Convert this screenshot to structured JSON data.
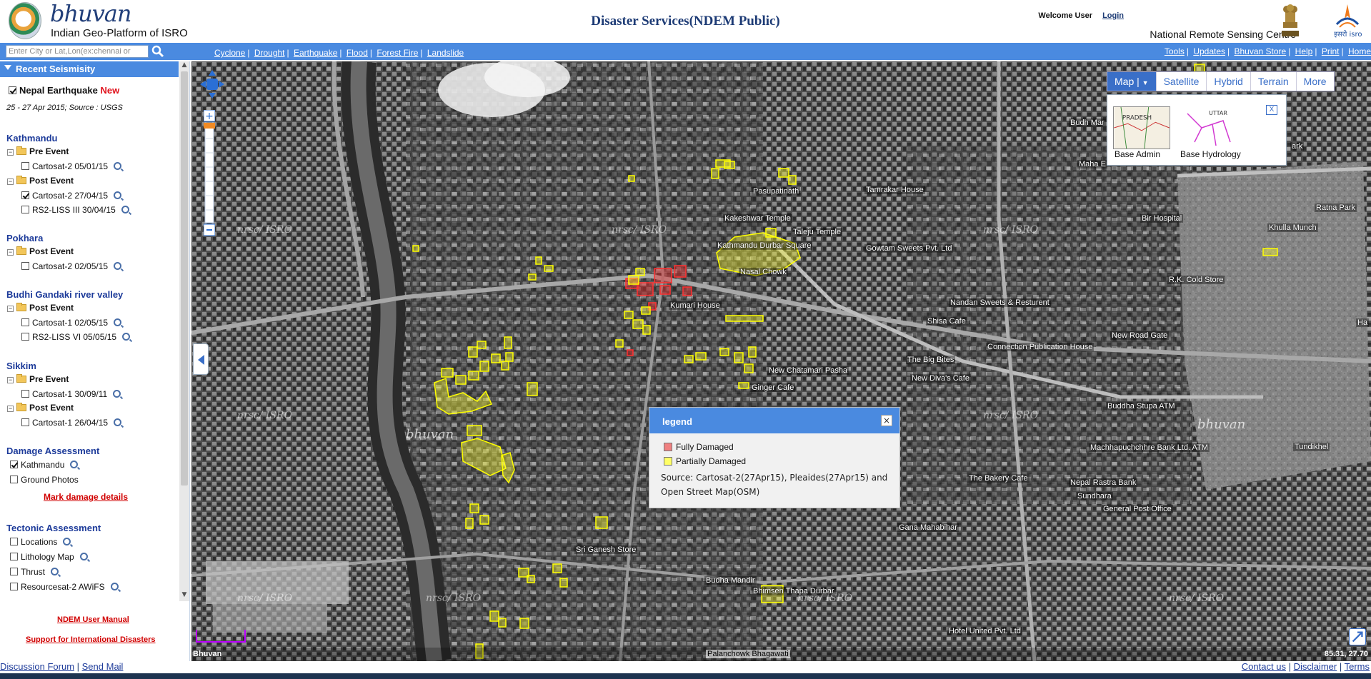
{
  "header": {
    "logo_word": "bhuvan",
    "logo_tagline": "Indian Geo-Platform of ISRO",
    "title": "Disaster Services(NDEM Public)",
    "welcome": "Welcome User",
    "login": "Login",
    "org": "National Remote Sensing Centre"
  },
  "toolbar": {
    "search_placeholder": "Enter City or Lat,Lon(ex:chennai or",
    "disasters": [
      "Cyclone",
      "Drought",
      "Earthquake",
      "Flood",
      "Forest Fire",
      "Landslide"
    ],
    "tools": [
      "Tools",
      "Updates",
      "Bhuvan Store",
      "Help",
      "Print",
      "Home"
    ]
  },
  "sidebar": {
    "panel_title": "Recent Seismisity",
    "event": {
      "name": "Nepal Earthquake",
      "badge": "New",
      "date_source": "25 - 27 Apr 2015; Source : USGS",
      "checked": true
    },
    "sections": [
      {
        "title": "Kathmandu",
        "groups": [
          {
            "name": "Pre Event",
            "items": [
              {
                "label": "Cartosat-2 05/01/15",
                "checked": false
              }
            ]
          },
          {
            "name": "Post Event",
            "items": [
              {
                "label": "Cartosat-2 27/04/15",
                "checked": true
              },
              {
                "label": "RS2-LISS III 30/04/15",
                "checked": false
              }
            ]
          }
        ]
      },
      {
        "title": "Pokhara",
        "groups": [
          {
            "name": "Post Event",
            "items": [
              {
                "label": "Cartosat-2 02/05/15",
                "checked": false
              }
            ]
          }
        ]
      },
      {
        "title": "Budhi Gandaki river valley",
        "groups": [
          {
            "name": "Post Event",
            "items": [
              {
                "label": "Cartosat-1 02/05/15",
                "checked": false
              },
              {
                "label": "RS2-LISS VI 05/05/15",
                "checked": false
              }
            ]
          }
        ]
      },
      {
        "title": "Sikkim",
        "groups": [
          {
            "name": "Pre Event",
            "items": [
              {
                "label": "Cartosat-1 30/09/11",
                "checked": false
              }
            ]
          },
          {
            "name": "Post Event",
            "items": [
              {
                "label": "Cartosat-1 26/04/15",
                "checked": false
              }
            ]
          }
        ]
      }
    ],
    "damage": {
      "title": "Damage Assessment",
      "items": [
        {
          "label": "Kathmandu",
          "checked": true
        },
        {
          "label": "Ground Photos",
          "checked": false
        }
      ],
      "link": "Mark damage details"
    },
    "tectonic": {
      "title": "Tectonic Assessment",
      "items": [
        {
          "label": "Locations"
        },
        {
          "label": "Lithology Map"
        },
        {
          "label": "Thrust"
        },
        {
          "label": "Resourcesat-2 AWiFS"
        }
      ]
    },
    "footer_links": [
      "NDEM User Manual",
      "Support for International Disasters"
    ]
  },
  "map": {
    "layer_buttons": [
      "Map",
      "Satellite",
      "Hybrid",
      "Terrain",
      "More"
    ],
    "active_layer": "Map",
    "base_layers": [
      "Base Admin",
      "Base Hydrology"
    ],
    "base_close": "X",
    "places": [
      "Budh Mar",
      "Maha E",
      "Pasupatinath",
      "Tamrakar House",
      "Kakeshwar Temple",
      "Taleju Temple",
      "Kathmandu Durbar Square",
      "Gowtam Sweets Pvt. Ltd",
      "Bir Hospital",
      "Ratna Park",
      "Khulla Munch",
      "Nasal Chowk",
      "R.K. Cold Store",
      "Kumari House",
      "Nandan Sweets & Resturent",
      "Shisa Cafe",
      "New Road Gate",
      "Connection Publication House",
      "The Big Bites",
      "New Chatamari Pasha",
      "New Diva's Cafe",
      "Ginger Cafe",
      "Buddha Stupa ATM",
      "Machhapuchchhre Bank Ltd. ATM",
      "Tundikhel",
      "The Bakery Cafe",
      "Nepal Rastra Bank",
      "Sundhara",
      "General Post Office",
      "Gana Mahabihar",
      "Sri Ganesh Store",
      "Budha Mandir",
      "Bhimsen Thapa Durbar",
      "Hotel United Pvt. Ltd",
      "ark",
      "Ha"
    ],
    "watermarks": [
      "nrsc/ ISRO",
      "bhuvan"
    ],
    "attribution": "Bhuvan",
    "road_label": "Palanchowk Bhagawati",
    "coords": "85.31, 27.70"
  },
  "legend": {
    "title": "legend",
    "close": "×",
    "items": [
      {
        "label": "Fully Damaged",
        "color": "#f08080"
      },
      {
        "label": "Partially Damaged",
        "color": "#ffff66"
      }
    ],
    "source": "Source: Cartosat-2(27Apr15), Pleaides(27Apr15) and Open Street Map(OSM)"
  },
  "footer": {
    "left": [
      "Discussion Forum",
      "Send Mail"
    ],
    "right": [
      "Contact us",
      "Disclaimer",
      "Terms"
    ]
  },
  "colors": {
    "accent": "#4a8ae0",
    "title_blue": "#1d3b75",
    "link_red": "#d10000",
    "damage_yellow": "#ffff33",
    "damage_red": "#e83030"
  }
}
